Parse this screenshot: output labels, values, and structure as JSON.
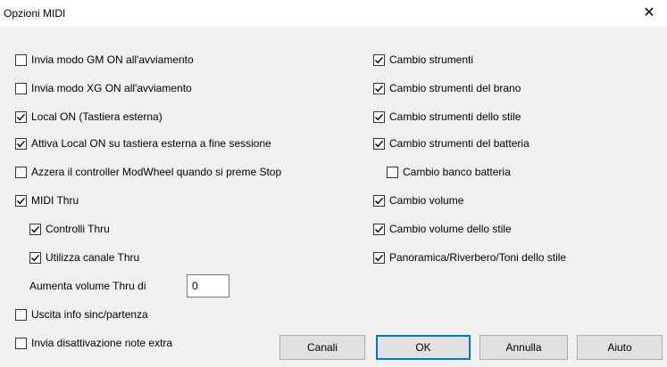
{
  "window": {
    "title": "Opzioni MIDI"
  },
  "left_options": [
    {
      "label": "Invia modo GM ON all'avviamento",
      "checked": false
    },
    {
      "label": "Invia modo XG ON all'avviamento",
      "checked": false
    },
    {
      "label": "Local ON (Tastiera esterna)",
      "checked": true
    },
    {
      "label": "Attiva Local ON su tastiera esterna a fine sessione",
      "checked": true
    },
    {
      "label": "Azzera il controller ModWheel quando si preme Stop",
      "checked": false
    },
    {
      "label": "MIDI Thru",
      "checked": true
    },
    {
      "label": "Controlli Thru",
      "checked": true
    },
    {
      "label": "Utilizza canale Thru",
      "checked": true
    },
    {
      "label": "Uscita info sinc/partenza",
      "checked": false
    },
    {
      "label": "Invia disattivazione note extra",
      "checked": false
    }
  ],
  "thru_volume": {
    "label": "Aumenta volume Thru di",
    "value": "0"
  },
  "right_options": [
    {
      "label": "Cambio strumenti",
      "checked": true
    },
    {
      "label": "Cambio strumenti del brano",
      "checked": true
    },
    {
      "label": "Cambio strumenti dello stile",
      "checked": true
    },
    {
      "label": "Cambio strumenti del batteria",
      "checked": true
    },
    {
      "label": "Cambio banco batteria",
      "checked": false
    },
    {
      "label": "Cambio volume",
      "checked": true
    },
    {
      "label": "Cambio volume dello stile",
      "checked": true
    },
    {
      "label": "Panoramica/Riverbero/Toni dello stile",
      "checked": true
    }
  ],
  "buttons": {
    "canali": "Canali",
    "ok": "OK",
    "annulla": "Annulla",
    "aiuto": "Aiuto"
  }
}
